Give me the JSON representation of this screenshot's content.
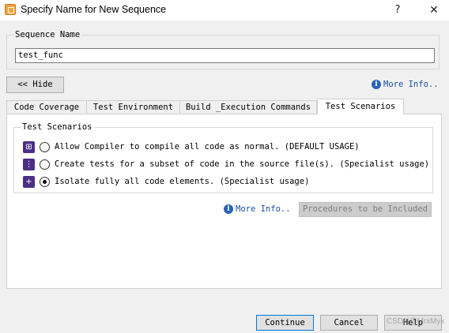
{
  "window": {
    "title": "Specify Name for New Sequence",
    "help_glyph": "?",
    "close_glyph": "✕",
    "app_icon": "dialog-app-icon"
  },
  "sequence": {
    "group_label": "Sequence Name",
    "value": "test_func"
  },
  "controls": {
    "hide_label": "<< Hide",
    "more_info_top": "More Info..",
    "more_info_mid": "More Info.."
  },
  "tabs": [
    {
      "label": "Code Coverage",
      "active": false
    },
    {
      "label": "Test Environment",
      "active": false
    },
    {
      "label": "Build _Execution Commands",
      "active": false
    },
    {
      "label": "Test Scenarios",
      "active": true
    }
  ],
  "scenarios": {
    "group_label": "Test Scenarios",
    "options": [
      {
        "label": "Allow Compiler to compile all code as normal. (DEFAULT USAGE)",
        "icon": "compile-all-icon",
        "selected": false
      },
      {
        "label": "Create tests for a subset of code in the source file(s). (Specialist usage)",
        "icon": "subset-icon",
        "selected": false
      },
      {
        "label": "Isolate fully all code elements. (Specialist usage)",
        "icon": "isolate-icon",
        "selected": true
      }
    ]
  },
  "procedures_button": "Procedures to be Included",
  "footer": {
    "continue": "Continue",
    "cancel": "Cancel",
    "help": "Help"
  },
  "watermark": "CSDN@MrxMyx",
  "colors": {
    "accent": "#0078d7",
    "link": "#1a4fa0",
    "icon_purple": "#4b2f86",
    "app_icon": "#f3a33a"
  }
}
